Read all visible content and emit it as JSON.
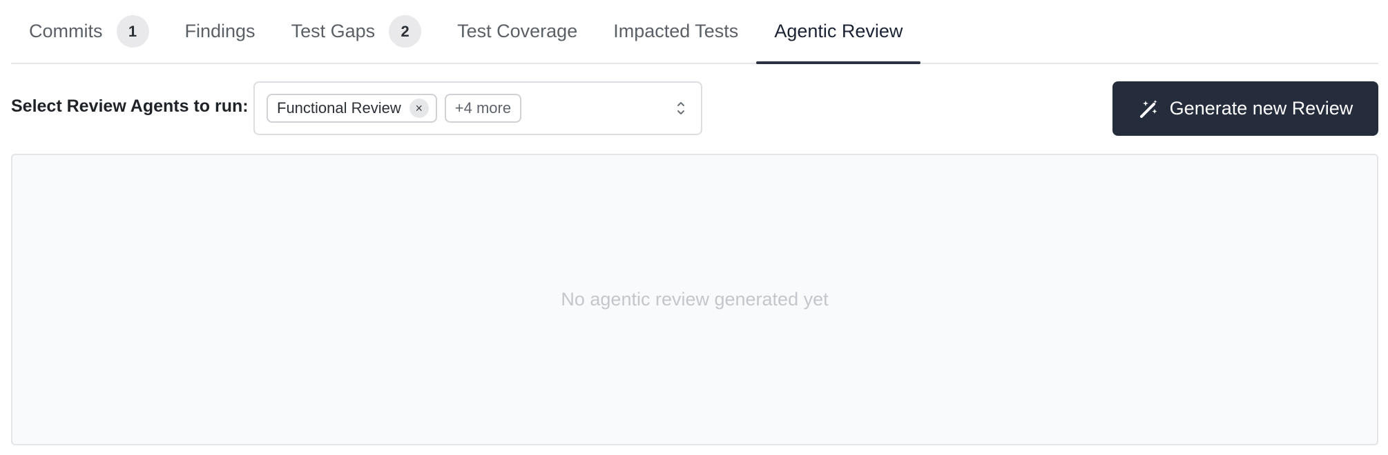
{
  "tabs": [
    {
      "label": "Commits",
      "badge": "1"
    },
    {
      "label": "Findings"
    },
    {
      "label": "Test Gaps",
      "badge": "2"
    },
    {
      "label": "Test Coverage"
    },
    {
      "label": "Impacted Tests"
    },
    {
      "label": "Agentic Review",
      "active": true
    }
  ],
  "toolbar": {
    "select_label": "Select Review Agents to run:",
    "selected_agent": "Functional Review",
    "chip_remove": "×",
    "more_label": "+4 more",
    "generate_label": "Generate new Review",
    "generate_icon": "magic-wand-icon"
  },
  "panel": {
    "empty_text": "No agentic review generated yet"
  },
  "colors": {
    "button_bg": "#252d3d",
    "active_tab_underline": "#2a3140",
    "panel_bg": "#f9fafc"
  }
}
